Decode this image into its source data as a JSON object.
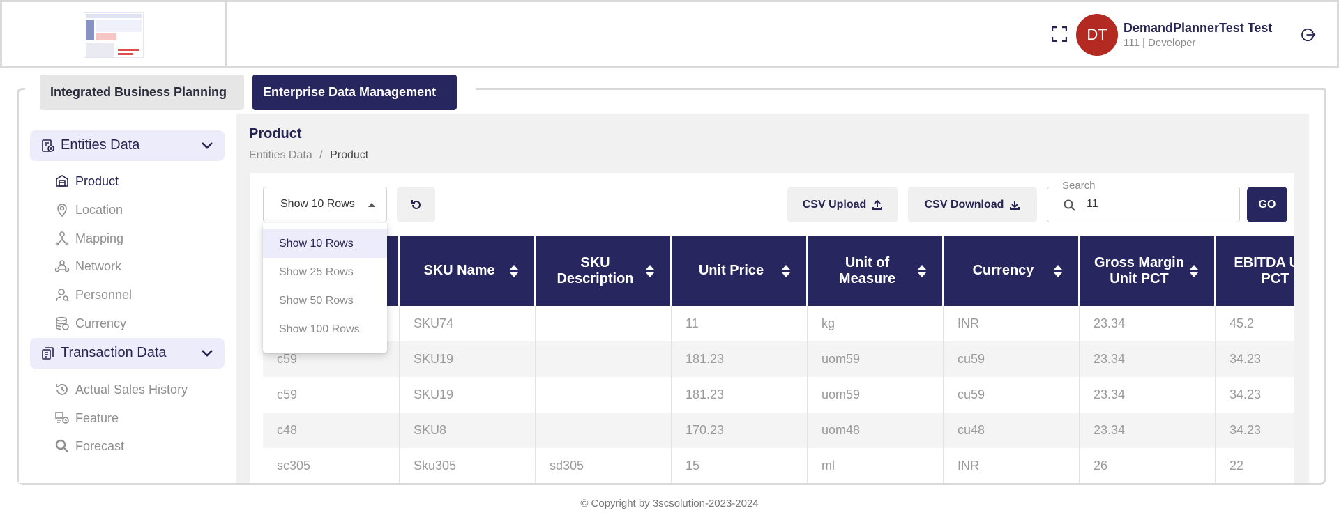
{
  "header": {
    "user_initials": "DT",
    "user_name": "DemandPlannerTest Test",
    "user_role": "111 | Developer",
    "avatar_color": "#b32a22"
  },
  "tabs": [
    {
      "label": "Integrated Business Planning",
      "active": false
    },
    {
      "label": "Enterprise Data Management",
      "active": true
    }
  ],
  "sidebar": {
    "groups": [
      {
        "label": "Entities Data",
        "items": [
          {
            "label": "Product",
            "icon": "product-icon",
            "active": true
          },
          {
            "label": "Location",
            "icon": "location-icon"
          },
          {
            "label": "Mapping",
            "icon": "mapping-icon"
          },
          {
            "label": "Network",
            "icon": "network-icon"
          },
          {
            "label": "Personnel",
            "icon": "personnel-icon"
          },
          {
            "label": "Currency",
            "icon": "currency-icon"
          }
        ]
      },
      {
        "label": "Transaction Data",
        "items": [
          {
            "label": "Actual Sales History",
            "icon": "history-icon"
          },
          {
            "label": "Feature",
            "icon": "feature-icon"
          },
          {
            "label": "Forecast",
            "icon": "search-icon"
          }
        ]
      }
    ]
  },
  "main": {
    "title": "Product",
    "breadcrumb": {
      "parent": "Entities Data",
      "separator": "/",
      "current": "Product"
    },
    "toolbar": {
      "rows_value": "Show 10 Rows",
      "csv_upload": "CSV Upload",
      "csv_download": "CSV Download",
      "search_label": "Search",
      "search_value": "11",
      "go": "GO"
    },
    "rows_options": [
      "Show 10 Rows",
      "Show 25 Rows",
      "Show 50 Rows",
      "Show 100 Rows"
    ],
    "table": {
      "columns": [
        "",
        "SKU Name",
        "SKU Description",
        "Unit Price",
        "Unit of Measure",
        "Currency",
        "Gross Margin Unit PCT",
        "EBITDA Unit PCT"
      ],
      "rows": [
        [
          "",
          "SKU74",
          "",
          "11",
          "kg",
          "INR",
          "23.34",
          "45.2"
        ],
        [
          "c59",
          "SKU19",
          "",
          "181.23",
          "uom59",
          "cu59",
          "23.34",
          "34.23"
        ],
        [
          "c59",
          "SKU19",
          "",
          "181.23",
          "uom59",
          "cu59",
          "23.34",
          "34.23"
        ],
        [
          "c48",
          "SKU8",
          "",
          "170.23",
          "uom48",
          "cu48",
          "23.34",
          "34.23"
        ],
        [
          "sc305",
          "Sku305",
          "sd305",
          "15",
          "ml",
          "INR",
          "26",
          "22"
        ]
      ]
    }
  },
  "footer": {
    "copyright": "© Copyright by 3scsolution-2023-2024"
  },
  "colors": {
    "primary": "#27265e",
    "accent_bg": "#ececfb"
  }
}
